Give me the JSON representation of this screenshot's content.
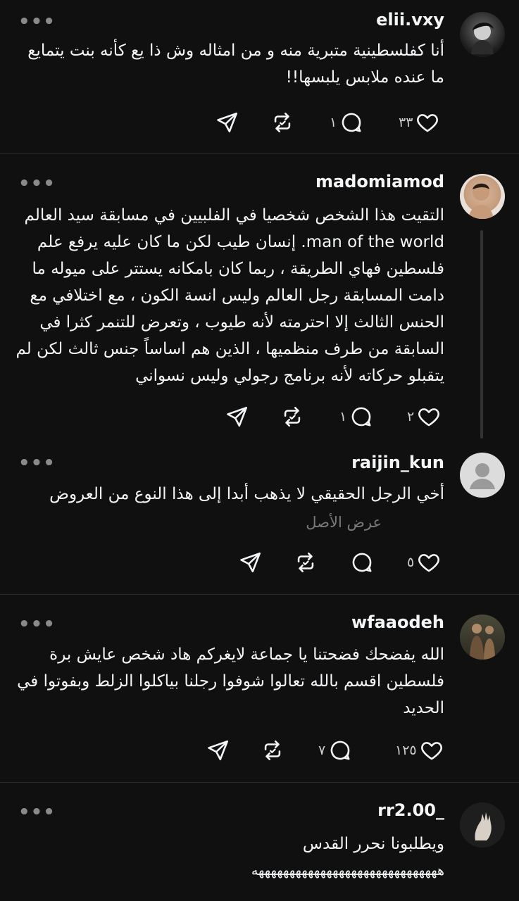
{
  "posts": [
    {
      "username": "elii.vxy",
      "text": "أنا كفلسطينية متبرية منه و من امثاله وش ذا يع كأنه بنت يتمايع ما عنده ملابس يلبسها!!",
      "likes": "٣٣",
      "replies": "١",
      "more_label": "•••"
    },
    {
      "username": "madomiamod",
      "text": "التقيت هذا الشخص شخصيا في الفلبيين في مسابقة سيد العالم man of the world. إنسان طيب لكن ما كان عليه يرفع علم فلسطين فهاي الطريقة ، ربما كان بامكانه يستتر على ميوله ما دامت المسابقة رجل العالم وليس انسة الكون ، مع اختلافي مع الحنس الثالث إلا احترمته لأنه طيوب ، وتعرض للتنمر كثرا في السابقة من طرف منظميها ، الذين هم اساساً جنس ثالث لكن لم يتقبلو حركاته لأنه برنامج رجولي وليس نسواني",
      "likes": "٢",
      "replies": "١",
      "more_label": "•••"
    },
    {
      "username": "raijin_kun",
      "text": "أخي الرجل الحقيقي لا يذهب أبدا إلى هذا النوع من العروض",
      "translate_label": "عرض الأصل",
      "likes": "٥",
      "replies": "",
      "more_label": "•••"
    },
    {
      "username": "wfaaodeh",
      "text": "الله يفضحك فضحتنا يا جماعة لايغركم هاد شخص عايش برة فلسطين اقسم بالله تعالوا شوفوا رجلنا بياكلوا الزلط وبفوتوا في الحديد",
      "likes": "١٢٥",
      "replies": "٧",
      "more_label": "•••"
    },
    {
      "username": "rr2.00_",
      "text": "ويطلبونا نحرر القدس",
      "text2": "ههههههههههههههههههههههههههههههه",
      "more_label": "•••"
    }
  ],
  "icons": [
    "like-icon",
    "reply-icon",
    "repost-icon",
    "share-icon",
    "more-icon"
  ],
  "colors": {
    "background": "#101010",
    "text": "#f3f5f7",
    "muted": "#8a8a8a",
    "divider": "#2a2a2a"
  }
}
